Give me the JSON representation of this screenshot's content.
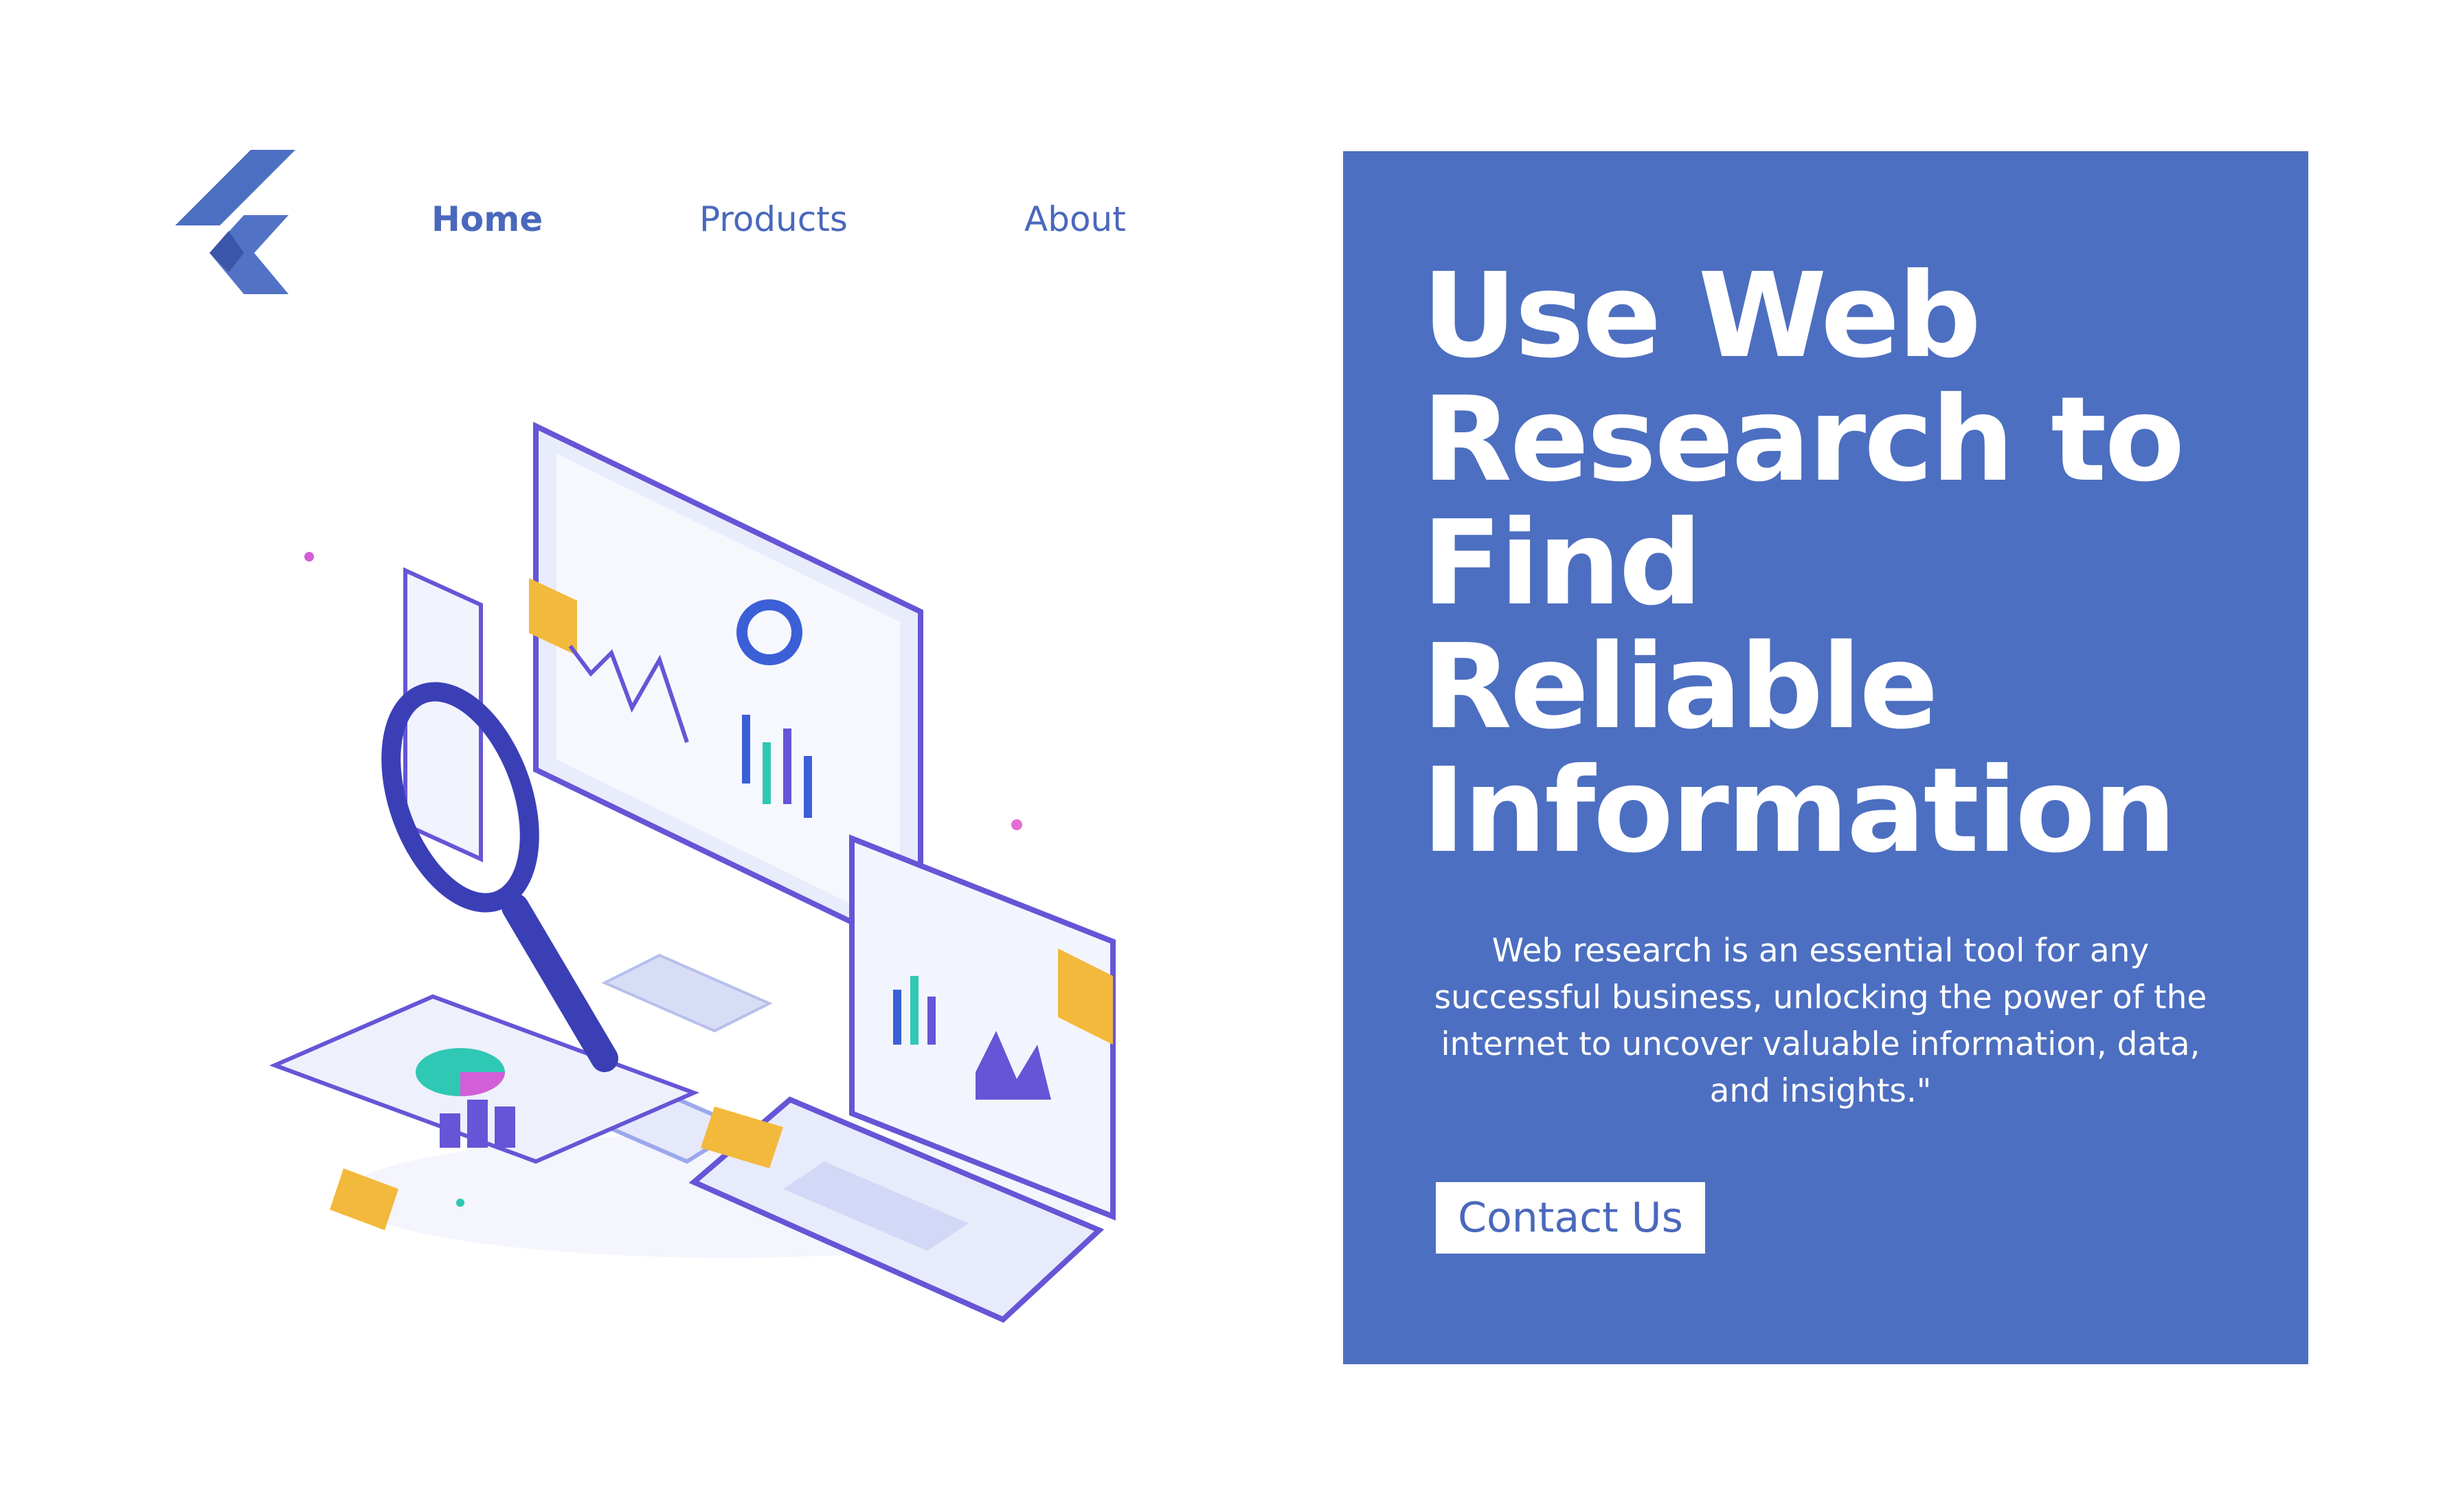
{
  "brand": {
    "logo_icon": "chevron-left-logo-icon",
    "accent_color": "#4D6FC1",
    "text_color": "#4A68BC"
  },
  "nav": {
    "items": [
      {
        "label": "Home",
        "active": true
      },
      {
        "label": "Products",
        "active": false
      },
      {
        "label": "About",
        "active": false
      }
    ]
  },
  "hero": {
    "headline_lines": [
      "Use Web",
      "Research to",
      "Find",
      "Reliable",
      "Information"
    ],
    "description": "Web research is an essential tool for any successful business, unlocking the power of the internet to uncover valuable information, data, and insights.\"",
    "cta_label": "Contact Us",
    "illustration_icon": "web-research-devices-illustration"
  }
}
